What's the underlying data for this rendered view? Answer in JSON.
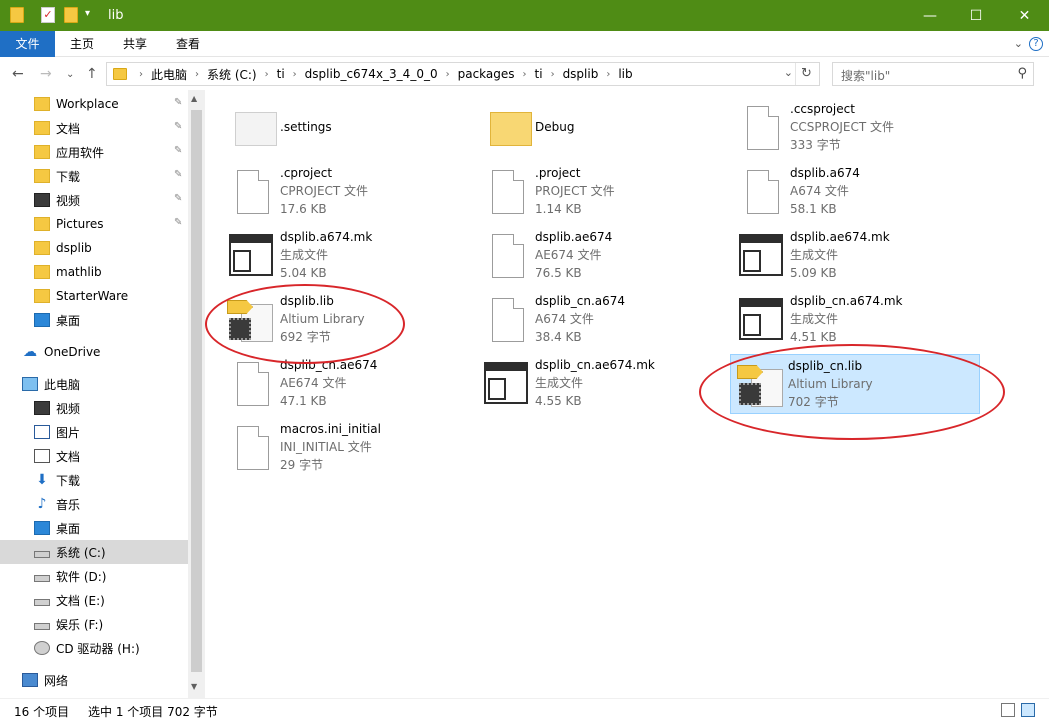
{
  "window": {
    "title": "lib",
    "controls": {
      "minimize": "—",
      "maximize": "☐",
      "close": "✕"
    }
  },
  "ribbon": {
    "tabs": [
      "文件",
      "主页",
      "共享",
      "查看"
    ],
    "help": "?"
  },
  "address": {
    "breadcrumbs": [
      "此电脑",
      "系统 (C:)",
      "ti",
      "dsplib_c674x_3_4_0_0",
      "packages",
      "ti",
      "dsplib",
      "lib"
    ],
    "search_placeholder": "搜索\"lib\""
  },
  "sidebar": {
    "quick_access": [
      {
        "label": "Workplace",
        "icon": "folder-icon",
        "pinned": true
      },
      {
        "label": "文档",
        "icon": "folder-icon",
        "pinned": true
      },
      {
        "label": "应用软件",
        "icon": "folder-icon",
        "pinned": true
      },
      {
        "label": "下载",
        "icon": "folder-icon",
        "pinned": true
      },
      {
        "label": "视频",
        "icon": "video-icon",
        "pinned": true
      },
      {
        "label": "Pictures",
        "icon": "folder-icon",
        "pinned": true
      },
      {
        "label": "dsplib",
        "icon": "folder-icon",
        "pinned": false
      },
      {
        "label": "mathlib",
        "icon": "folder-icon",
        "pinned": false
      },
      {
        "label": "StarterWare",
        "icon": "folder-icon",
        "pinned": false
      },
      {
        "label": "桌面",
        "icon": "desktop-icon",
        "pinned": false
      }
    ],
    "onedrive": "OneDrive",
    "this_pc": "此电脑",
    "pc_items": [
      {
        "label": "视频",
        "icon": "video-icon"
      },
      {
        "label": "图片",
        "icon": "pictures-icon"
      },
      {
        "label": "文档",
        "icon": "documents-icon"
      },
      {
        "label": "下载",
        "icon": "download-icon"
      },
      {
        "label": "音乐",
        "icon": "music-icon"
      },
      {
        "label": "桌面",
        "icon": "desktop-icon"
      },
      {
        "label": "系统 (C:)",
        "icon": "system-drive-icon",
        "selected": true
      },
      {
        "label": "软件 (D:)",
        "icon": "drive-icon"
      },
      {
        "label": "文档 (E:)",
        "icon": "drive-icon"
      },
      {
        "label": "娱乐 (F:)",
        "icon": "drive-icon"
      },
      {
        "label": "CD 驱动器 (H:)",
        "icon": "cd-drive-icon"
      }
    ],
    "network": "网络"
  },
  "files": [
    {
      "name": ".settings",
      "type": "",
      "size": "",
      "icon": "folder-icon"
    },
    {
      "name": "Debug",
      "type": "",
      "size": "",
      "icon": "folder-icon"
    },
    {
      "name": ".ccsproject",
      "type": "CCSPROJECT 文件",
      "size": "333 字节",
      "icon": "file-icon"
    },
    {
      "name": ".cproject",
      "type": "CPROJECT 文件",
      "size": "17.6 KB",
      "icon": "file-icon"
    },
    {
      "name": ".project",
      "type": "PROJECT 文件",
      "size": "1.14 KB",
      "icon": "file-icon"
    },
    {
      "name": "dsplib.a674",
      "type": "A674 文件",
      "size": "58.1 KB",
      "icon": "file-icon"
    },
    {
      "name": "dsplib.a674.mk",
      "type": "生成文件",
      "size": "5.04 KB",
      "icon": "makefile-icon"
    },
    {
      "name": "dsplib.ae674",
      "type": "AE674 文件",
      "size": "76.5 KB",
      "icon": "file-icon"
    },
    {
      "name": "dsplib.ae674.mk",
      "type": "生成文件",
      "size": "5.09 KB",
      "icon": "makefile-icon"
    },
    {
      "name": "dsplib.lib",
      "type": "Altium Library",
      "size": "692 字节",
      "icon": "altium-library-icon"
    },
    {
      "name": "dsplib_cn.a674",
      "type": "A674 文件",
      "size": "38.4 KB",
      "icon": "file-icon"
    },
    {
      "name": "dsplib_cn.a674.mk",
      "type": "生成文件",
      "size": "4.51 KB",
      "icon": "makefile-icon"
    },
    {
      "name": "dsplib_cn.ae674",
      "type": "AE674 文件",
      "size": "47.1 KB",
      "icon": "file-icon"
    },
    {
      "name": "dsplib_cn.ae674.mk",
      "type": "生成文件",
      "size": "4.55 KB",
      "icon": "makefile-icon"
    },
    {
      "name": "dsplib_cn.lib",
      "type": "Altium Library",
      "size": "702 字节",
      "icon": "altium-library-icon",
      "selected": true
    },
    {
      "name": "macros.ini_initial",
      "type": "INI_INITIAL 文件",
      "size": "29 字节",
      "icon": "file-icon"
    }
  ],
  "status": {
    "count": "16 个项目",
    "selection": "选中 1 个项目  702 字节"
  },
  "annotation_color": "#d8262a"
}
